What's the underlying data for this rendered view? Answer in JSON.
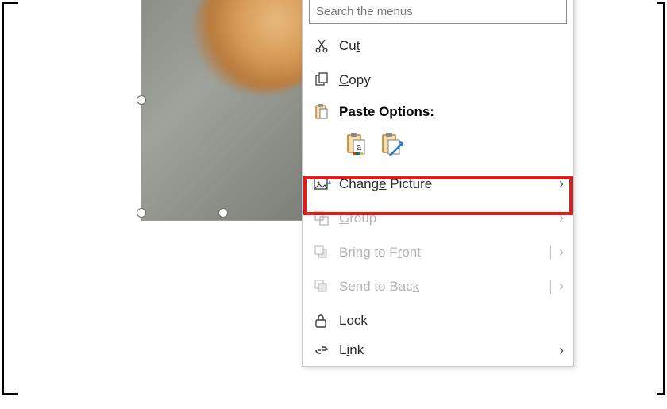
{
  "search": {
    "placeholder": "Search the menus"
  },
  "menu": {
    "cut": "Cut",
    "copy": "Copy",
    "paste_options": "Paste Options:",
    "change_picture": "Change Picture",
    "group": "Group",
    "bring_to_front": "Bring to Front",
    "send_to_back": "Send to Back",
    "lock": "Lock",
    "link": "Link"
  }
}
